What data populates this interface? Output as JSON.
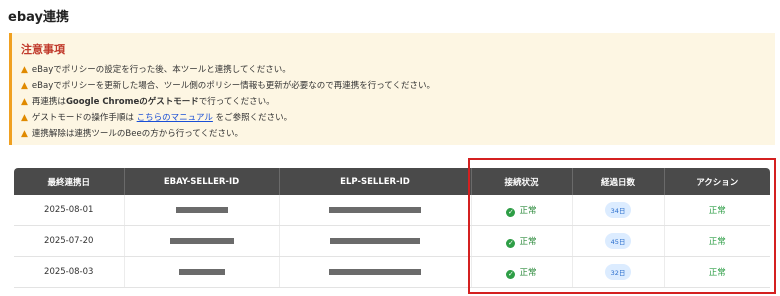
{
  "page": {
    "title": "ebay連携"
  },
  "notice": {
    "heading": "注意事項",
    "icon": "warning-icon",
    "lines": {
      "l1": "eBayでポリシーの設定を行った後、本ツールと連携してください。",
      "l2": "eBayでポリシーを更新した場合、ツール側のポリシー情報も更新が必要なので再連携を行ってください。",
      "l3_pre": "再連携は",
      "l3_bold": "Google Chromeのゲストモード",
      "l3_post": "で行ってください。",
      "l4_pre": "ゲストモードの操作手順は",
      "l4_link": "こちらのマニュアル",
      "l4_post": "をご参照ください。",
      "l5": "連携解除は連携ツールのBeeの方から行ってください。"
    }
  },
  "table": {
    "headers": {
      "last_sync": "最終連携日",
      "ebay_seller_id": "EBAY-SELLER-ID",
      "elp_seller_id": "ELP-SELLER-ID",
      "status": "接続状況",
      "elapsed_days": "経過日数",
      "action": "アクション"
    },
    "rows": [
      {
        "date": "2025-08-01",
        "status": "正常",
        "days": "34日",
        "action": "正常"
      },
      {
        "date": "2025-07-20",
        "status": "正常",
        "days": "45日",
        "action": "正常"
      },
      {
        "date": "2025-08-03",
        "status": "正常",
        "days": "32日",
        "action": "正常"
      }
    ]
  },
  "colors": {
    "header_bg": "#4a4a4a",
    "notice_bg": "#fdf6e3",
    "status_green": "#2e9e46",
    "badge_bg": "#dcecff",
    "highlight_red": "#d42020"
  }
}
